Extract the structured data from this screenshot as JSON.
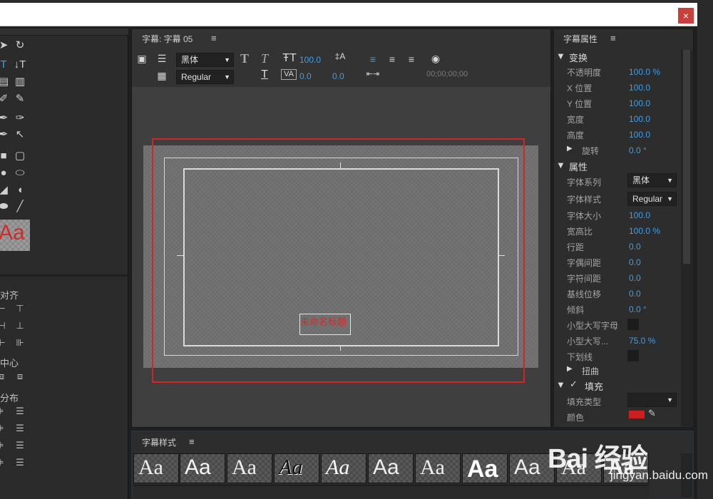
{
  "window": {
    "close_glyph": "×"
  },
  "left": {
    "preview_glyph": "Aa",
    "align_section": "对齐",
    "center_section": "中心",
    "distribute_section": "分布"
  },
  "center": {
    "tab_title": "字幕: 字幕 05",
    "menu_glyph": "≡",
    "font_family": "黑体",
    "font_style": "Regular",
    "font_size": "100.0",
    "kerning": "0.0",
    "tracking": "0.0",
    "timecode": "00;00;00;00",
    "title_text": "未命名标题"
  },
  "props": {
    "header": "字幕属性",
    "menu_glyph": "≡",
    "sections": {
      "transform": "变换",
      "properties": "属性",
      "distort": "扭曲",
      "fill": "填充"
    },
    "transform": {
      "opacity_label": "不透明度",
      "opacity_value": "100.0 %",
      "x_label": "X 位置",
      "x_value": "100.0",
      "y_label": "Y 位置",
      "y_value": "100.0",
      "w_label": "宽度",
      "w_value": "100.0",
      "h_label": "高度",
      "h_value": "100.0",
      "rot_label": "旋转",
      "rot_value": "0.0 °"
    },
    "properties": {
      "family_label": "字体系列",
      "family_value": "黑体",
      "style_label": "字体样式",
      "style_value": "Regular",
      "size_label": "字体大小",
      "size_value": "100.0",
      "aspect_label": "宽高比",
      "aspect_value": "100.0 %",
      "leading_label": "行距",
      "leading_value": "0.0",
      "kerning_label": "字偶间距",
      "kerning_value": "0.0",
      "tracking_label": "字符间距",
      "tracking_value": "0.0",
      "baseline_label": "基线位移",
      "baseline_value": "0.0",
      "slant_label": "倾斜",
      "slant_value": "0.0 °",
      "smallcaps_label": "小型大写字母",
      "smallcaps_size_label": "小型大写...",
      "smallcaps_size_value": "75.0 %",
      "underline_label": "下划线"
    },
    "fill": {
      "check": "✓",
      "type_label": "填充类型",
      "color_label": "颜色",
      "color_value": "#cc2020"
    }
  },
  "styles": {
    "header": "字幕样式",
    "menu_glyph": "≡",
    "samples": [
      "Aa",
      "Aa",
      "Aa",
      "Aa",
      "Aa",
      "Aa",
      "Aa",
      "Aa",
      "Aa",
      "Aa",
      "Aa"
    ]
  },
  "watermark": {
    "logo": "Bai 经验",
    "url": "jingyan.baidu.com"
  },
  "colors": {
    "accent": "#3f9fe6",
    "highlight": "#d0262a",
    "fill_color": "#cc2020"
  }
}
